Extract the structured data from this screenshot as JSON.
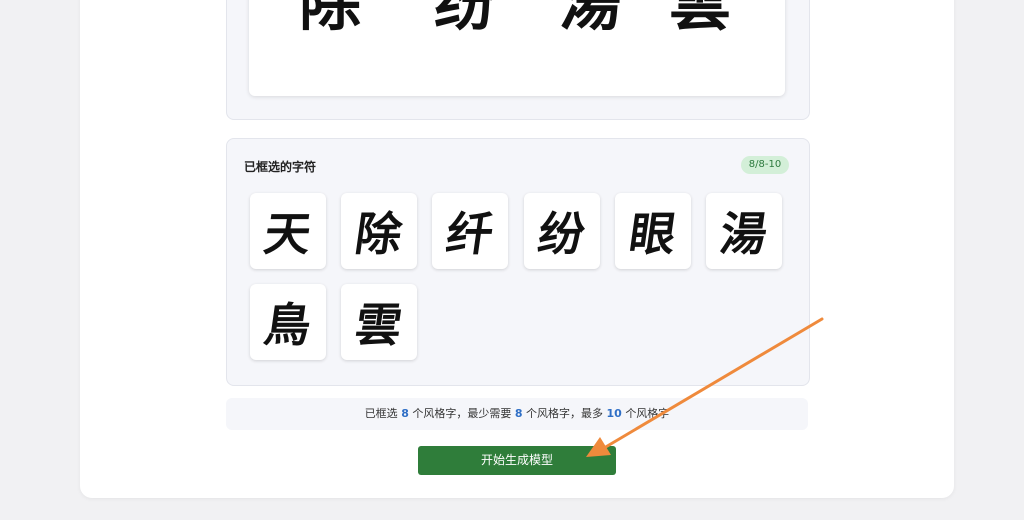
{
  "top_preview": {
    "glyphs": [
      "除",
      "纷",
      "湯",
      "雲"
    ]
  },
  "selection": {
    "title": "已框选的字符",
    "badge": "8/8-10",
    "characters": [
      "天",
      "除",
      "纤",
      "纷",
      "眼",
      "湯",
      "鳥",
      "雲"
    ]
  },
  "info": {
    "prefix": "已框选",
    "selected": "8",
    "mid1": "个风格字，最少需要",
    "min": "8",
    "mid2": "个风格字，最多",
    "max": "10",
    "suffix": "个风格字"
  },
  "actions": {
    "generate_label": "开始生成模型"
  },
  "colors": {
    "accent_green": "#2f7d3a",
    "badge_bg": "#d3efd8",
    "number_blue": "#2f6fc6",
    "annotation_arrow": "#ef8a3c"
  }
}
